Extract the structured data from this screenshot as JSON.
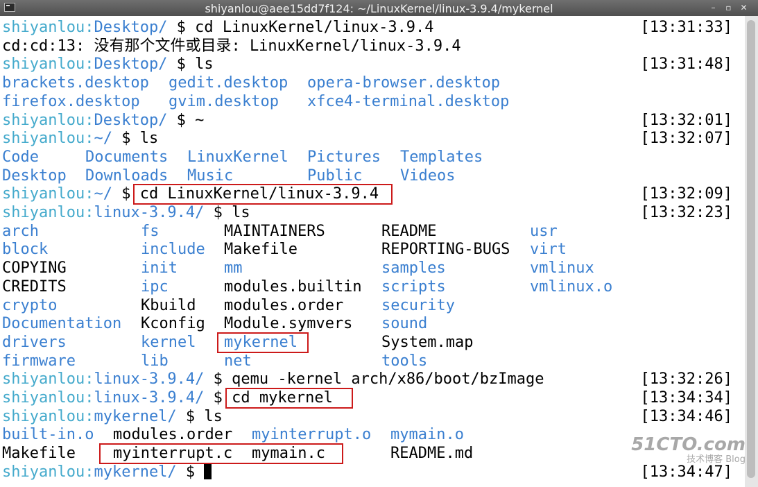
{
  "window": {
    "title": "shiyanlou@aee15dd7f124: ~/LinuxKernel/linux-3.9.4/mykernel"
  },
  "terminal": {
    "lines": [
      {
        "user": "shiyanlou",
        "sep": ":",
        "path": "Desktop/",
        "cmd": " $ cd LinuxKernel/linux-3.9.4",
        "time": "[13:31:33]"
      },
      {
        "text": "cd:cd:13: 没有那个文件或目录: LinuxKernel/linux-3.9.4"
      },
      {
        "user": "shiyanlou",
        "sep": ":",
        "path": "Desktop/",
        "cmd": " $ ls",
        "time": "[13:31:48]"
      },
      {
        "user": "shiyanlou",
        "sep": ":",
        "path": "Desktop/",
        "cmd": " $ ~",
        "time": "[13:32:01]"
      },
      {
        "user": "shiyanlou",
        "sep": ":",
        "path": "~/",
        "cmd": " $ ls",
        "time": "[13:32:07]"
      },
      {
        "user": "shiyanlou",
        "sep": ":",
        "path": "~/",
        "cmd": " $ cd LinuxKernel/linux-3.9.4",
        "time": "[13:32:09]"
      },
      {
        "user": "shiyanlou",
        "sep": ":",
        "path": "linux-3.9.4/",
        "cmd": " $ ls",
        "time": "[13:32:23]"
      },
      {
        "user": "shiyanlou",
        "sep": ":",
        "path": "linux-3.9.4/",
        "cmd": " $ qemu -kernel arch/x86/boot/bzImage",
        "time": "[13:32:26]"
      },
      {
        "user": "shiyanlou",
        "sep": ":",
        "path": "linux-3.9.4/",
        "cmd": " $ cd mykernel",
        "time": "[13:34:34]"
      },
      {
        "user": "shiyanlou",
        "sep": ":",
        "path": "mykernel/",
        "cmd": " $ ls",
        "time": "[13:34:46]"
      },
      {
        "user": "shiyanlou",
        "sep": ":",
        "path": "mykernel/",
        "cmd": " $ ",
        "time": "[13:34:47]"
      }
    ],
    "desktop_listing": [
      [
        "brackets.desktop",
        "gedit.desktop",
        "opera-browser.desktop"
      ],
      [
        "firefox.desktop",
        "gvim.desktop",
        "xfce4-terminal.desktop"
      ]
    ],
    "home_listing": [
      [
        "Code",
        "Documents",
        "LinuxKernel",
        "Pictures",
        "Templates"
      ],
      [
        "Desktop",
        "Downloads",
        "Music",
        "Public",
        "Videos"
      ]
    ],
    "kernel_listing": [
      [
        {
          "t": "arch",
          "d": true
        },
        {
          "t": "fs",
          "d": true
        },
        {
          "t": "MAINTAINERS",
          "d": false
        },
        {
          "t": "README",
          "d": false
        },
        {
          "t": "usr",
          "d": true
        }
      ],
      [
        {
          "t": "block",
          "d": true
        },
        {
          "t": "include",
          "d": true
        },
        {
          "t": "Makefile",
          "d": false
        },
        {
          "t": "REPORTING-BUGS",
          "d": false
        },
        {
          "t": "virt",
          "d": true
        }
      ],
      [
        {
          "t": "COPYING",
          "d": false
        },
        {
          "t": "init",
          "d": true
        },
        {
          "t": "mm",
          "d": true
        },
        {
          "t": "samples",
          "d": true
        },
        {
          "t": "vmlinux",
          "d": true
        }
      ],
      [
        {
          "t": "CREDITS",
          "d": false
        },
        {
          "t": "ipc",
          "d": true
        },
        {
          "t": "modules.builtin",
          "d": false
        },
        {
          "t": "scripts",
          "d": true
        },
        {
          "t": "vmlinux.o",
          "d": true
        }
      ],
      [
        {
          "t": "crypto",
          "d": true
        },
        {
          "t": "Kbuild",
          "d": false
        },
        {
          "t": "modules.order",
          "d": false
        },
        {
          "t": "security",
          "d": true
        },
        {
          "t": "",
          "d": false
        }
      ],
      [
        {
          "t": "Documentation",
          "d": true
        },
        {
          "t": "Kconfig",
          "d": false
        },
        {
          "t": "Module.symvers",
          "d": false
        },
        {
          "t": "sound",
          "d": true
        },
        {
          "t": "",
          "d": false
        }
      ],
      [
        {
          "t": "drivers",
          "d": true
        },
        {
          "t": "kernel",
          "d": true
        },
        {
          "t": "mykernel",
          "d": true
        },
        {
          "t": "System.map",
          "d": false
        },
        {
          "t": "",
          "d": false
        }
      ],
      [
        {
          "t": "firmware",
          "d": true
        },
        {
          "t": "lib",
          "d": true
        },
        {
          "t": "net",
          "d": true
        },
        {
          "t": "tools",
          "d": true
        },
        {
          "t": "",
          "d": false
        }
      ]
    ],
    "mykernel_listing": [
      [
        {
          "t": "built-in.o",
          "d": true
        },
        {
          "t": "modules.order",
          "d": false
        },
        {
          "t": "myinterrupt.o",
          "d": true
        },
        {
          "t": "mymain.o",
          "d": true
        }
      ],
      [
        {
          "t": "Makefile",
          "d": false
        },
        {
          "t": "myinterrupt.c",
          "d": false
        },
        {
          "t": "mymain.c",
          "d": false
        },
        {
          "t": "README.md",
          "d": false
        }
      ]
    ]
  },
  "watermark": {
    "logo": "51CTO.com",
    "subtitle": "技术博客 Blog"
  },
  "colors": {
    "user": "#44aacc",
    "path": "#3a7fd0",
    "highlight": "#cc1a1a"
  }
}
